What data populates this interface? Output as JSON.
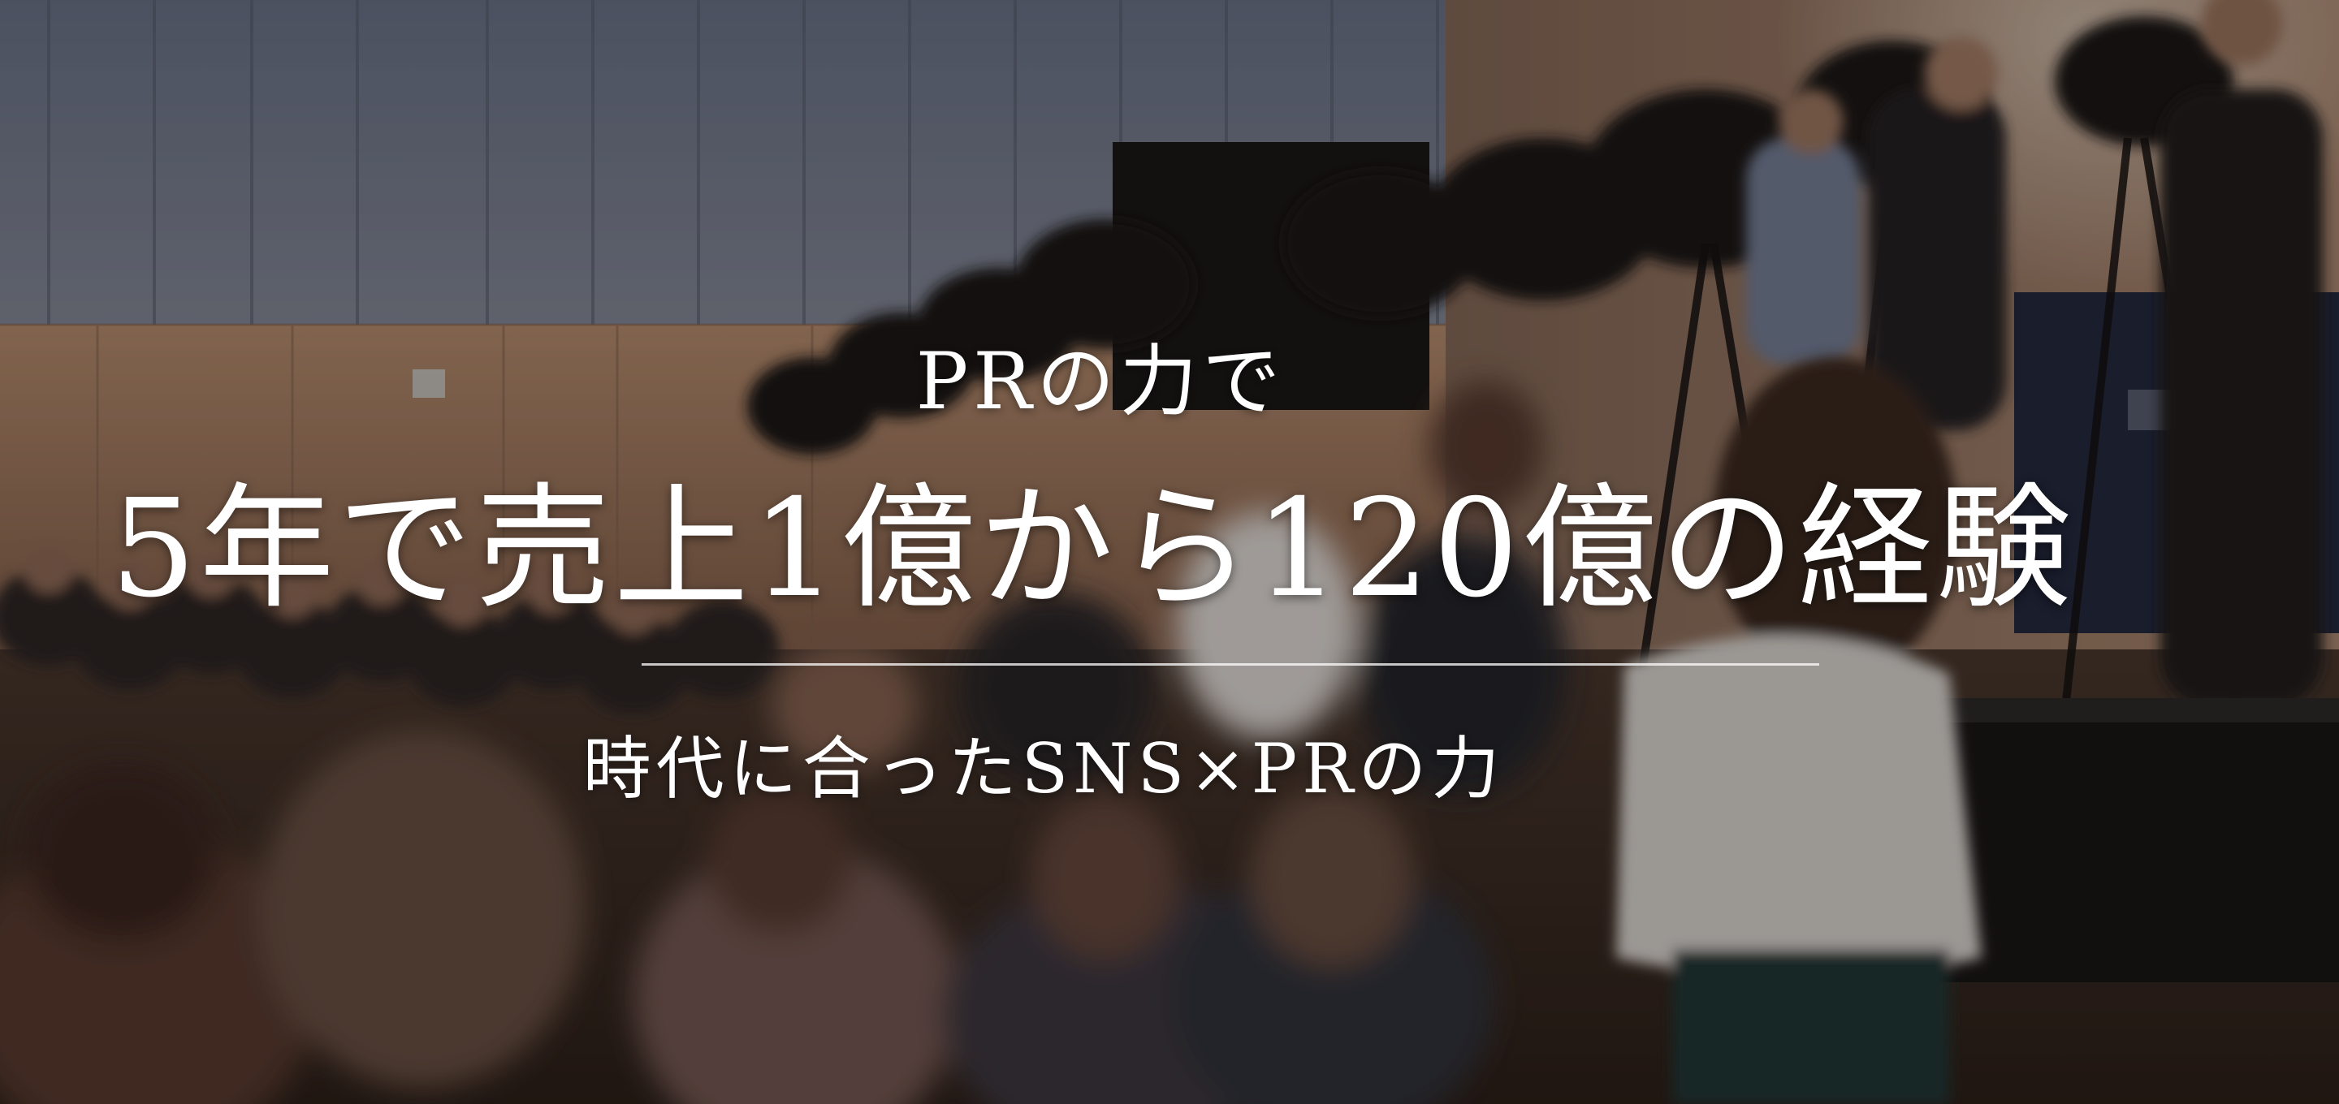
{
  "hero": {
    "sub_title": "PRの力で",
    "main_title": "5年で売上1億から120億の経験",
    "tagline": "時代に合ったSNS×PRの力"
  },
  "colors": {
    "text": "#ffffff",
    "overlay": "#140c08",
    "divider": "#ffffff",
    "wall": "#b08a6c",
    "ceiling": "#7d8aa0"
  }
}
